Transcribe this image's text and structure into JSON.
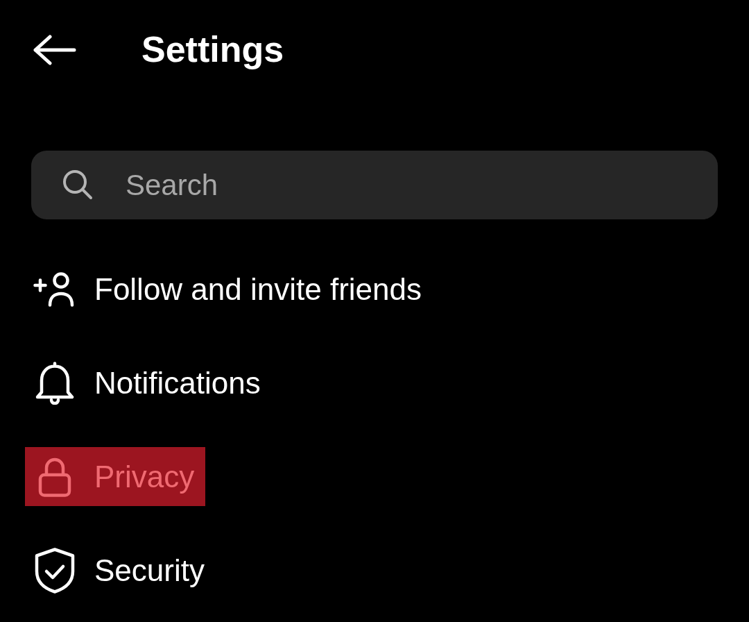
{
  "header": {
    "title": "Settings"
  },
  "search": {
    "placeholder": "Search"
  },
  "menu_items": [
    {
      "label": "Follow and invite friends",
      "selected": false
    },
    {
      "label": "Notifications",
      "selected": false
    },
    {
      "label": "Privacy",
      "selected": true
    },
    {
      "label": "Security",
      "selected": false
    }
  ]
}
